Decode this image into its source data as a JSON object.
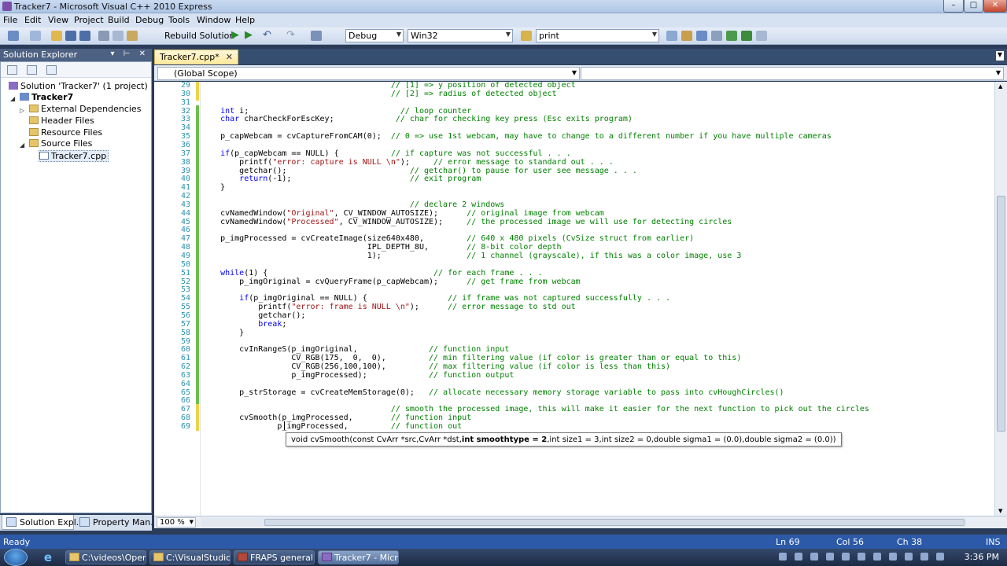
{
  "window": {
    "title": "Tracker7 - Microsoft Visual C++ 2010 Express",
    "min": "–",
    "max": "□",
    "close": "✕"
  },
  "menu": [
    "File",
    "Edit",
    "View",
    "Project",
    "Build",
    "Debug",
    "Tools",
    "Window",
    "Help"
  ],
  "toolbar": {
    "rebuild_label": "Rebuild Solution",
    "config": "Debug",
    "platform": "Win32",
    "find_value": "print"
  },
  "solution_explorer": {
    "title": "Solution Explorer",
    "pins": "▾ ⊢ ✕",
    "items": [
      {
        "label": "Solution 'Tracker7' (1 project)"
      },
      {
        "label": "Tracker7"
      },
      {
        "label": "External Dependencies"
      },
      {
        "label": "Header Files"
      },
      {
        "label": "Resource Files"
      },
      {
        "label": "Source Files"
      },
      {
        "label": "Tracker7.cpp"
      }
    ],
    "tabs": [
      "Solution Expl...",
      "Property Man..."
    ]
  },
  "editor": {
    "tab_label": "Tracker7.cpp*",
    "tab_close": "✕",
    "scope": "(Global Scope)",
    "zoom": "100 %",
    "tooltip_pre": "void cvSmooth(const CvArr *src,CvArr *dst,",
    "tooltip_bold": "int smoothtype = 2",
    "tooltip_post": ",int size1 = 3,int size2 = 0,double sigma1 = (0.0),double sigma2 = (0.0))"
  },
  "code_lines": [
    {
      "n": "29",
      "segs": [
        [
          "                                        ",
          ""
        ],
        [
          "// [1] => y position of detected object",
          "cm"
        ]
      ]
    },
    {
      "n": "30",
      "segs": [
        [
          "                                        ",
          ""
        ],
        [
          "// [2] => radius of detected object",
          "cm"
        ]
      ]
    },
    {
      "n": "31",
      "segs": []
    },
    {
      "n": "32",
      "segs": [
        [
          "    ",
          ""
        ],
        [
          "int",
          "kw"
        ],
        [
          " i;                                ",
          ""
        ],
        [
          "// loop counter",
          "cm"
        ]
      ]
    },
    {
      "n": "33",
      "segs": [
        [
          "    ",
          ""
        ],
        [
          "char",
          "kw"
        ],
        [
          " charCheckForEscKey;             ",
          ""
        ],
        [
          "// char for checking key press (Esc exits program)",
          "cm"
        ]
      ]
    },
    {
      "n": "34",
      "segs": []
    },
    {
      "n": "35",
      "segs": [
        [
          "    p_capWebcam = cvCaptureFromCAM(0);  ",
          ""
        ],
        [
          "// 0 => use 1st webcam, may have to change to a different number if you have multiple cameras",
          "cm"
        ]
      ]
    },
    {
      "n": "36",
      "segs": []
    },
    {
      "n": "37",
      "segs": [
        [
          "    ",
          ""
        ],
        [
          "if",
          "kw"
        ],
        [
          "(p_capWebcam == NULL) {           ",
          ""
        ],
        [
          "// if capture was not successful . . .",
          "cm"
        ]
      ]
    },
    {
      "n": "38",
      "segs": [
        [
          "        printf(",
          ""
        ],
        [
          "\"error: capture is NULL \\n\"",
          "st"
        ],
        [
          ");     ",
          ""
        ],
        [
          "// error message to standard out . . .",
          "cm"
        ]
      ]
    },
    {
      "n": "39",
      "segs": [
        [
          "        getchar();                          ",
          ""
        ],
        [
          "// getchar() to pause for user see message . . .",
          "cm"
        ]
      ]
    },
    {
      "n": "40",
      "segs": [
        [
          "        ",
          ""
        ],
        [
          "return",
          "kw"
        ],
        [
          "(-1);                         ",
          ""
        ],
        [
          "// exit program",
          "cm"
        ]
      ]
    },
    {
      "n": "41",
      "segs": [
        [
          "    }",
          ""
        ]
      ]
    },
    {
      "n": "42",
      "segs": []
    },
    {
      "n": "43",
      "segs": [
        [
          "                                            ",
          ""
        ],
        [
          "// declare 2 windows",
          "cm"
        ]
      ]
    },
    {
      "n": "44",
      "segs": [
        [
          "    cvNamedWindow(",
          ""
        ],
        [
          "\"Original\"",
          "st"
        ],
        [
          ", CV_WINDOW_AUTOSIZE);      ",
          ""
        ],
        [
          "// original image from webcam",
          "cm"
        ]
      ]
    },
    {
      "n": "45",
      "segs": [
        [
          "    cvNamedWindow(",
          ""
        ],
        [
          "\"Processed\"",
          "st"
        ],
        [
          ", CV_WINDOW_AUTOSIZE);     ",
          ""
        ],
        [
          "// the processed image we will use for detecting circles",
          "cm"
        ]
      ]
    },
    {
      "n": "46",
      "segs": []
    },
    {
      "n": "47",
      "segs": [
        [
          "    p_imgProcessed = cvCreateImage(size640x480,         ",
          ""
        ],
        [
          "// 640 x 480 pixels (CvSize struct from earlier)",
          "cm"
        ]
      ]
    },
    {
      "n": "48",
      "segs": [
        [
          "                                   IPL_DEPTH_8U,        ",
          ""
        ],
        [
          "// 8-bit color depth",
          "cm"
        ]
      ]
    },
    {
      "n": "49",
      "segs": [
        [
          "                                   1);                  ",
          ""
        ],
        [
          "// 1 channel (grayscale), if this was a color image, use 3",
          "cm"
        ]
      ]
    },
    {
      "n": "50",
      "segs": []
    },
    {
      "n": "51",
      "segs": [
        [
          "    ",
          ""
        ],
        [
          "while",
          "kw"
        ],
        [
          "(1) {                                   ",
          ""
        ],
        [
          "// for each frame . . .",
          "cm"
        ]
      ]
    },
    {
      "n": "52",
      "segs": [
        [
          "        p_imgOriginal = cvQueryFrame(p_capWebcam);      ",
          ""
        ],
        [
          "// get frame from webcam",
          "cm"
        ]
      ]
    },
    {
      "n": "53",
      "segs": []
    },
    {
      "n": "54",
      "segs": [
        [
          "        ",
          ""
        ],
        [
          "if",
          "kw"
        ],
        [
          "(p_imgOriginal == NULL) {                 ",
          ""
        ],
        [
          "// if frame was not captured successfully . . .",
          "cm"
        ]
      ]
    },
    {
      "n": "55",
      "segs": [
        [
          "            printf(",
          ""
        ],
        [
          "\"error: frame is NULL \\n\"",
          "st"
        ],
        [
          ");      ",
          ""
        ],
        [
          "// error message to std out",
          "cm"
        ]
      ]
    },
    {
      "n": "56",
      "segs": [
        [
          "            getchar();",
          ""
        ]
      ]
    },
    {
      "n": "57",
      "segs": [
        [
          "            ",
          ""
        ],
        [
          "break",
          "kw"
        ],
        [
          ";",
          ""
        ]
      ]
    },
    {
      "n": "58",
      "segs": [
        [
          "        }",
          ""
        ]
      ]
    },
    {
      "n": "59",
      "segs": []
    },
    {
      "n": "60",
      "segs": [
        [
          "        cvInRangeS(p_imgOriginal,               ",
          ""
        ],
        [
          "// function input",
          "cm"
        ]
      ]
    },
    {
      "n": "61",
      "segs": [
        [
          "                   CV_RGB(175,  0,  0),         ",
          ""
        ],
        [
          "// min filtering value (if color is greater than or equal to this)",
          "cm"
        ]
      ]
    },
    {
      "n": "62",
      "segs": [
        [
          "                   CV_RGB(256,100,100),         ",
          ""
        ],
        [
          "// max filtering value (if color is less than this)",
          "cm"
        ]
      ]
    },
    {
      "n": "63",
      "segs": [
        [
          "                   p_imgProcessed);             ",
          ""
        ],
        [
          "// function output",
          "cm"
        ]
      ]
    },
    {
      "n": "64",
      "segs": []
    },
    {
      "n": "65",
      "segs": [
        [
          "        p_strStorage = cvCreateMemStorage(0);   ",
          ""
        ],
        [
          "// allocate necessary memory storage variable to pass into cvHoughCircles()",
          "cm"
        ]
      ]
    },
    {
      "n": "66",
      "segs": []
    },
    {
      "n": "67",
      "segs": [
        [
          "                                        ",
          ""
        ],
        [
          "// smooth the processed image, this will make it easier for the next function to pick out the circles",
          "cm"
        ]
      ]
    },
    {
      "n": "68",
      "segs": [
        [
          "        cvSmooth(p_imgProcessed,        ",
          ""
        ],
        [
          "// function input",
          "cm"
        ]
      ]
    },
    {
      "n": "69",
      "segs": [
        [
          "                p_imgProcessed,         ",
          ""
        ],
        [
          "// function out",
          "cm"
        ]
      ]
    }
  ],
  "status": {
    "ready": "Ready",
    "ln": "Ln 69",
    "col": "Col 56",
    "ch": "Ch 38",
    "ins": "INS"
  },
  "taskbar": {
    "buttons": [
      "C:\\videos\\Open...",
      "C:\\VisualStudio...",
      "FRAPS general",
      "Tracker7 - Micr..."
    ],
    "clock": "3:36 PM"
  }
}
